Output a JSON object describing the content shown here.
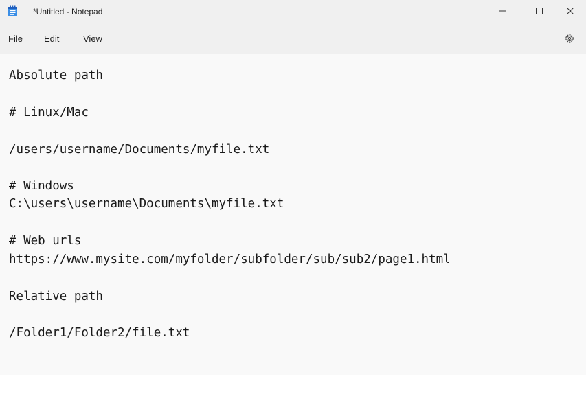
{
  "window": {
    "title": "*Untitled - Notepad",
    "icons": {
      "app": "notepad-icon",
      "minimize": "minimize-icon",
      "maximize": "maximize-icon",
      "close": "close-icon",
      "settings": "gear-icon"
    }
  },
  "menu": {
    "file": "File",
    "edit": "Edit",
    "view": "View"
  },
  "editor": {
    "lines": [
      "Absolute path",
      "# Linux/Mac",
      "/users/username/Documents/myfile.txt",
      "# Windows",
      "C:\\users\\username\\Documents\\myfile.txt",
      "# Web urls",
      "https://www.mysite.com/myfolder/subfolder/sub/sub2/page1.html",
      "Relative path",
      "/Folder1/Folder2/file.txt"
    ]
  },
  "colors": {
    "chrome_bg": "#f0f0f0",
    "editor_bg": "#f9f9f9",
    "text": "#1a1a1a",
    "icon_blue": "#2b6cd4"
  }
}
